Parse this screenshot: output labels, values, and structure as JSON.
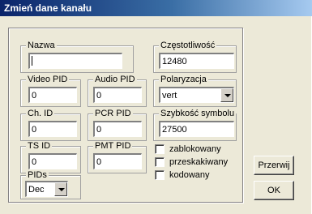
{
  "window": {
    "title": "Zmień dane kanału"
  },
  "fields": {
    "nazwa": {
      "label": "Nazwa",
      "value": ""
    },
    "czestotliwosc": {
      "label": "Częstotliwość",
      "value": "12480"
    },
    "video_pid": {
      "label": "Video PID",
      "value": "0"
    },
    "audio_pid": {
      "label": "Audio PID",
      "value": "0"
    },
    "polaryzacja": {
      "label": "Polaryzacja",
      "value": "vert"
    },
    "ch_id": {
      "label": "Ch. ID",
      "value": "0"
    },
    "pcr_pid": {
      "label": "PCR PID",
      "value": "0"
    },
    "szybkosc": {
      "label": "Szybkość symbolu",
      "value": "27500"
    },
    "ts_id": {
      "label": "TS ID",
      "value": "0"
    },
    "pmt_pid": {
      "label": "PMT PID",
      "value": "0"
    },
    "pids": {
      "label": "PIDs",
      "value": "Dec"
    }
  },
  "checkboxes": [
    {
      "label": "zablokowany",
      "checked": false
    },
    {
      "label": "przeskakiwany",
      "checked": false
    },
    {
      "label": "kodowany",
      "checked": false
    }
  ],
  "buttons": {
    "przerwij": "Przerwij",
    "ok": "OK"
  }
}
